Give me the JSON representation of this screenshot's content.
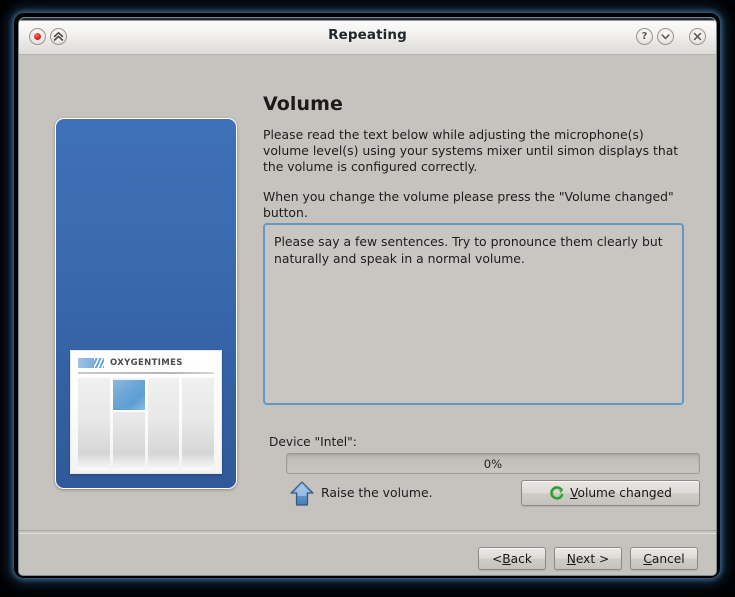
{
  "window": {
    "title": "Repeating",
    "titlebar_buttons": [
      {
        "name": "record-button",
        "icon": "record-dot-icon"
      },
      {
        "name": "shade-button",
        "icon": "double-chevron-up-icon"
      },
      {
        "name": "help-button",
        "icon": "question-mark-icon",
        "glyph": "?"
      },
      {
        "name": "window-menu-button",
        "icon": "chevron-down-icon",
        "glyph": "˅"
      },
      {
        "name": "close-button",
        "icon": "close-x-icon",
        "glyph": "✕"
      }
    ]
  },
  "sidebar": {
    "newspaper": {
      "masthead_title": "OXYGENTIMES",
      "column_count": 4,
      "photo_column_index": 1
    },
    "banner_color": "#3a69ae"
  },
  "content": {
    "page_title": "Volume",
    "paragraph_1": "Please read the text below while adjusting the microphone(s) volume level(s) using your systems mixer until simon displays that the volume is configured correctly.",
    "paragraph_2": "When you change the volume please press the \"Volume changed\" button.",
    "prompt_text": "Please say a few sentences. Try to pronounce them clearly but naturally and speak in a normal volume.",
    "prompt_border_color": "#5f9ac6"
  },
  "device": {
    "label": "Device \"Intel\":",
    "progress_percent": 0,
    "progress_label": "0%"
  },
  "hint": {
    "icon": "arrow-up-icon",
    "text": "Raise the volume.",
    "arrow_color": "#5585bf"
  },
  "buttons": {
    "volume_changed": {
      "icon": "refresh-circular-arrow-icon",
      "icon_color": "#2f9b32",
      "accel": "V",
      "label_before": "",
      "label_after": "olume changed"
    },
    "back": {
      "label_before": "< ",
      "accel": "B",
      "label_after": "ack"
    },
    "next": {
      "label_before": "",
      "accel": "N",
      "label_after": "ext >"
    },
    "cancel": {
      "label_before": "",
      "accel": "C",
      "label_after": "ancel"
    }
  }
}
